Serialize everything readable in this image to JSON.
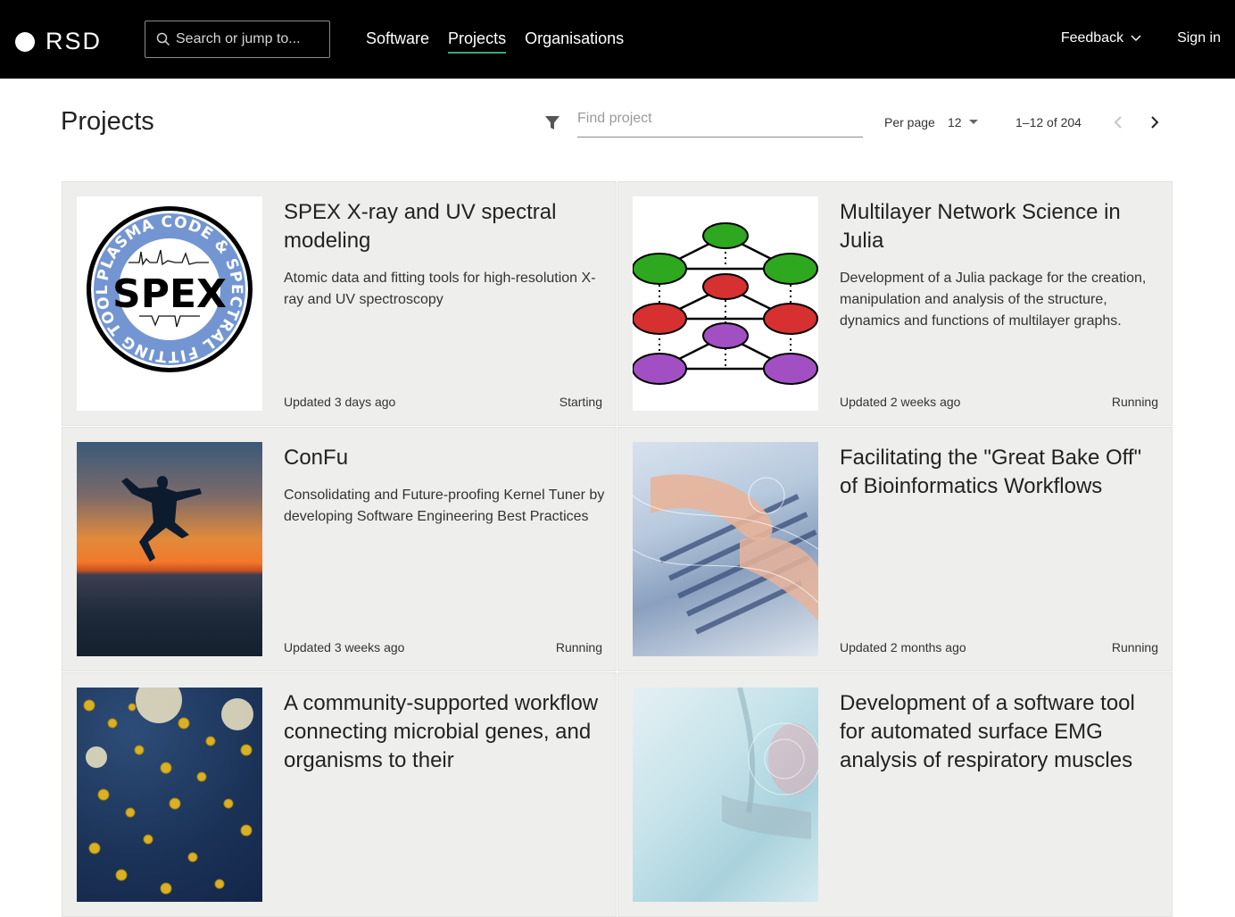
{
  "header": {
    "logo_text": "RSD",
    "search_placeholder": "Search or jump to...",
    "nav": [
      "Software",
      "Projects",
      "Organisations"
    ],
    "feedback": "Feedback",
    "sign_in": "Sign in"
  },
  "toolbar": {
    "title": "Projects",
    "find_placeholder": "Find project",
    "per_page_label": "Per page",
    "per_page_value": "12",
    "range": "1–12 of 204"
  },
  "projects": [
    {
      "title": "SPEX X-ray and UV spectral modeling",
      "description": "Atomic data and fitting tools for high-resolution X-ray and UV spectroscopy",
      "updated": "Updated 3 days ago",
      "status": "Starting",
      "logo": {
        "ring_text": "PLASMA CODE & SPECTRAL FITTING TOOL",
        "center": "SPEX"
      }
    },
    {
      "title": "Multilayer Network Science in Julia",
      "description": "Development of a Julia package for the creation, manipulation and analysis of the structure, dynamics and functions of multilayer graphs.",
      "updated": "Updated 2 weeks ago",
      "status": "Running"
    },
    {
      "title": "ConFu",
      "description": "Consolidating and Future-proofing Kernel Tuner by developing Software Engineering Best Practices",
      "updated": "Updated 3 weeks ago",
      "status": "Running"
    },
    {
      "title": "Facilitating the \"Great Bake Off\" of Bioinformatics Workflows",
      "description": "",
      "updated": "Updated 2 months ago",
      "status": "Running"
    },
    {
      "title": "A community-supported workflow connecting microbial genes, and organisms to their",
      "description": "",
      "updated": "",
      "status": ""
    },
    {
      "title": "Development of a software tool for automated surface EMG analysis of respiratory muscles",
      "description": "",
      "updated": "",
      "status": ""
    }
  ]
}
